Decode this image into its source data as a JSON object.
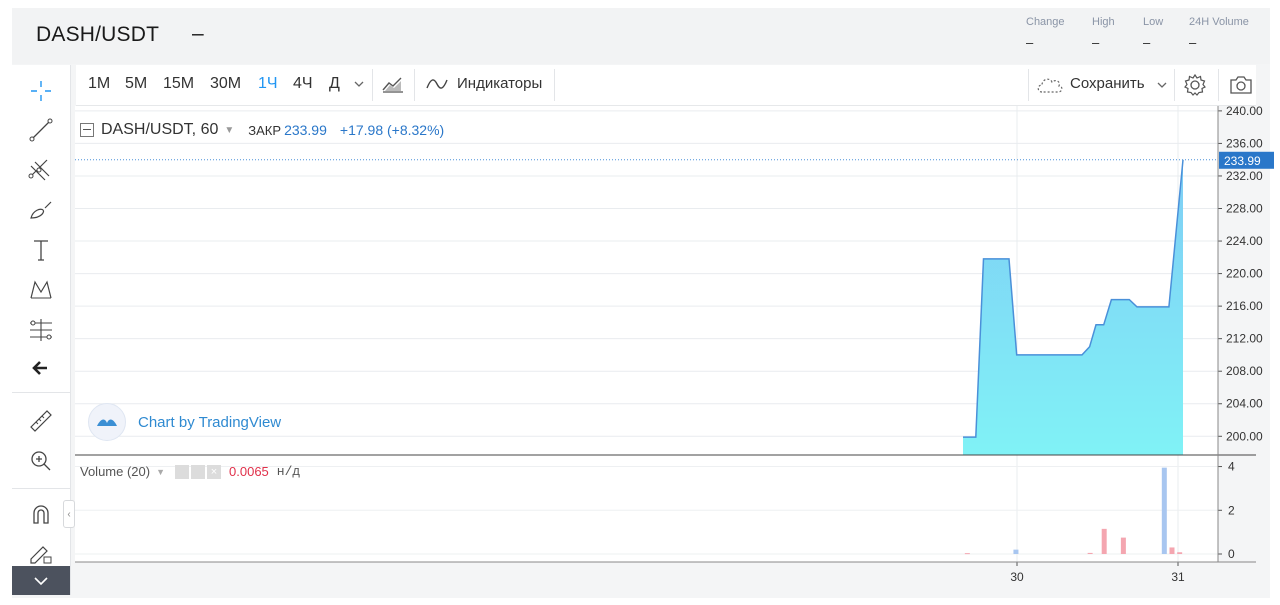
{
  "header": {
    "pair": "DASH/USDT",
    "dash": "–",
    "stats": [
      {
        "label": "Change",
        "value": "–"
      },
      {
        "label": "High",
        "value": "–"
      },
      {
        "label": "Low",
        "value": "–"
      },
      {
        "label": "24H Volume",
        "value": "–"
      }
    ]
  },
  "toolbar": {
    "timeframes": [
      "1M",
      "5M",
      "15M",
      "30M",
      "1Ч",
      "4Ч",
      "Д"
    ],
    "active_timeframe": "1Ч",
    "indicators_label": "Индикаторы",
    "save_label": "Сохранить"
  },
  "legend": {
    "symbol": "DASH/USDT, 60",
    "close_label": "ЗАКР",
    "close_value": "233.99",
    "change": "+17.98 (+8.32%)"
  },
  "volume_legend": {
    "label": "Volume (20)",
    "value": "0.0065",
    "unit": "н/д"
  },
  "watermark": "Chart by TradingView",
  "colors": {
    "accent": "#2196f3",
    "area_top": "#7fcdf5",
    "area_bottom": "#80f2f6",
    "line": "#4a90d9",
    "vol_up": "#a8c6f0",
    "vol_down": "#f4a6b0",
    "change_text": "#2a77c9"
  },
  "chart_data": {
    "type": "area",
    "price_axis": {
      "ticks": [
        "240.00",
        "236.00",
        "232.00",
        "228.00",
        "224.00",
        "220.00",
        "216.00",
        "212.00",
        "208.00",
        "204.00",
        "200.00"
      ],
      "ylim": [
        197.7,
        240.6
      ],
      "last_price_label": "233.99",
      "last_price": 233.99
    },
    "time_axis": {
      "ticks": [
        "30",
        "31"
      ]
    },
    "price_series": {
      "name": "DASH/USDT",
      "x": [
        0,
        1,
        2,
        3,
        4,
        5,
        6,
        7,
        8,
        9,
        10,
        11,
        12,
        13,
        14,
        15,
        16,
        17,
        18,
        19,
        20,
        21,
        22,
        23
      ],
      "points": [
        {
          "x": 0.0,
          "y": 199.9
        },
        {
          "x": 1.0,
          "y": 199.9
        },
        {
          "x": 1.6,
          "y": 221.8
        },
        {
          "x": 3.6,
          "y": 221.8
        },
        {
          "x": 4.2,
          "y": 210.0
        },
        {
          "x": 9.3,
          "y": 210.0
        },
        {
          "x": 9.9,
          "y": 211.0
        },
        {
          "x": 10.4,
          "y": 213.7
        },
        {
          "x": 11.0,
          "y": 213.7
        },
        {
          "x": 11.6,
          "y": 216.8
        },
        {
          "x": 13.0,
          "y": 216.8
        },
        {
          "x": 13.6,
          "y": 215.9
        },
        {
          "x": 16.1,
          "y": 215.9
        },
        {
          "x": 17.2,
          "y": 233.99
        }
      ],
      "x_range": [
        0,
        17.2
      ]
    },
    "volume_axis": {
      "ticks": [
        "4",
        "2",
        "0"
      ],
      "ylim": [
        0,
        4.3
      ]
    },
    "volume_bars": [
      {
        "x": 0.3,
        "v": 0.04,
        "dir": "down"
      },
      {
        "x": 4.1,
        "v": 0.2,
        "dir": "up"
      },
      {
        "x": 9.9,
        "v": 0.05,
        "dir": "down"
      },
      {
        "x": 11.0,
        "v": 1.15,
        "dir": "down"
      },
      {
        "x": 12.5,
        "v": 0.75,
        "dir": "down"
      },
      {
        "x": 15.7,
        "v": 3.95,
        "dir": "up"
      },
      {
        "x": 16.3,
        "v": 0.3,
        "dir": "down"
      },
      {
        "x": 16.9,
        "v": 0.08,
        "dir": "down"
      }
    ]
  }
}
